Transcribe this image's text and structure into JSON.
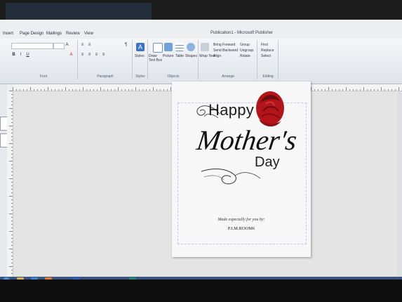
{
  "app": {
    "title": "Publication1 - Microsoft Publisher"
  },
  "tabs": [
    "Insert",
    "Page Design",
    "Mailings",
    "Review",
    "View"
  ],
  "ribbon": {
    "groups": {
      "font": "Font",
      "paragraph": "Paragraph",
      "styles": "Styles",
      "objects": "Objects",
      "arrange": "Arrange",
      "editing": "Editing"
    },
    "buttons": {
      "styles": "Styles",
      "draw_text_box": "Draw Text Box",
      "picture": "Picture",
      "table": "Table",
      "shapes": "Shapes",
      "wrap_text": "Wrap Text",
      "bring_forward": "Bring Forward",
      "send_backward": "Send Backward",
      "align": "Align",
      "group": "Group",
      "ungroup": "Ungroup",
      "rotate": "Rotate",
      "find": "Find",
      "replace": "Replace",
      "select": "Select"
    }
  },
  "card": {
    "happy": "Happy",
    "mothers": "Mother's",
    "day": "Day",
    "made_for": "Made especially for you by:",
    "author": "P.I.M.ROOM6"
  },
  "colors": {
    "rose": "#b3141a",
    "rose_dark": "#6e0a0e",
    "ribbon_bg": "#e8ebf0",
    "taskbar": "#2f4670"
  }
}
